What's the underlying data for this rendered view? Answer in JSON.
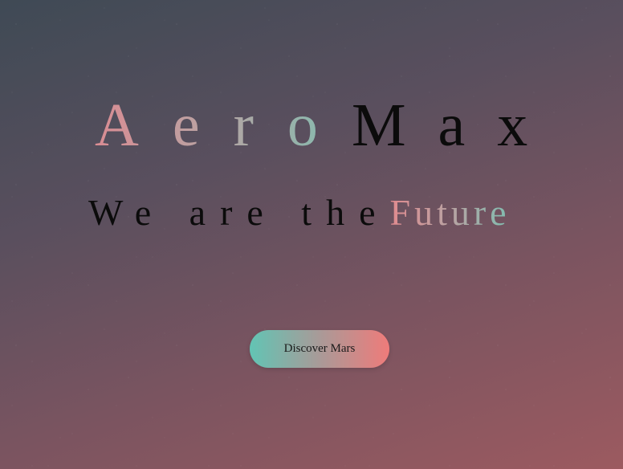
{
  "hero": {
    "brand_light": "Aero",
    "brand_dark": "Max",
    "tagline_dark": "We are the",
    "tagline_highlight": "Future",
    "cta_label": "Discover Mars"
  },
  "colors": {
    "background_top": "#3f4a55",
    "background_bottom": "#9c5a60",
    "accent_teal": "#62c4b4",
    "accent_coral": "#ef7b7a",
    "text_dark": "#0b0b0b"
  }
}
